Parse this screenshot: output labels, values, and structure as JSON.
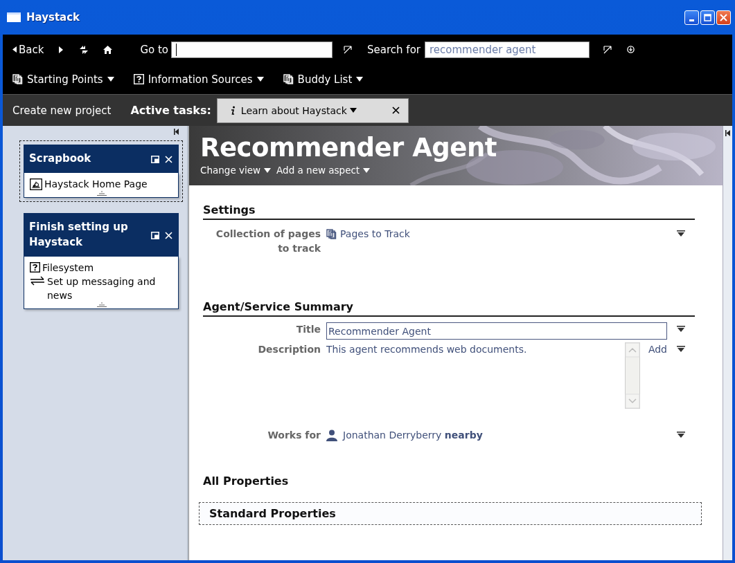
{
  "window": {
    "title": "Haystack"
  },
  "nav": {
    "back": "Back",
    "goto_label": "Go to",
    "search_label": "Search for",
    "search_value": "recommender agent"
  },
  "menus": [
    {
      "label": "Starting Points",
      "kind": "pages"
    },
    {
      "label": "Information Sources",
      "kind": "help"
    },
    {
      "label": "Buddy List",
      "kind": "pages"
    }
  ],
  "taskbar": {
    "create": "Create new project",
    "active_label": "Active tasks:",
    "tasks": [
      {
        "label": "Learn about Haystack"
      }
    ]
  },
  "sidebar": {
    "panels": [
      {
        "title": "Scrapbook",
        "selected": true,
        "items": [
          {
            "label": "Haystack Home Page",
            "kind": "web"
          }
        ]
      },
      {
        "title": "Finish setting up Haystack",
        "selected": false,
        "items": [
          {
            "label": "Filesystem",
            "kind": "help"
          },
          {
            "label": "Set up messaging and news",
            "kind": "exchange"
          }
        ]
      }
    ]
  },
  "page": {
    "title": "Recommender Agent",
    "actions": [
      "Change view",
      "Add a new aspect"
    ],
    "sections": [
      {
        "heading": "Settings",
        "kind": "ruled",
        "rows": [
          {
            "label": "Collection of pages to track",
            "kind": "link",
            "value": "Pages to Track"
          }
        ]
      },
      {
        "heading": "Agent/Service Summary",
        "kind": "ruled",
        "rows": [
          {
            "label": "Title",
            "kind": "field",
            "value": "Recommender Agent"
          },
          {
            "label": "Description",
            "kind": "textarea",
            "value": "This agent recommends web documents.",
            "extra": "Add"
          },
          {
            "label": "Works for",
            "kind": "person",
            "value": "Jonathan Derryberry **nearby**"
          }
        ]
      },
      {
        "heading": "All Properties",
        "kind": "plain"
      },
      {
        "heading": "Standard Properties",
        "kind": "boxed"
      }
    ]
  }
}
